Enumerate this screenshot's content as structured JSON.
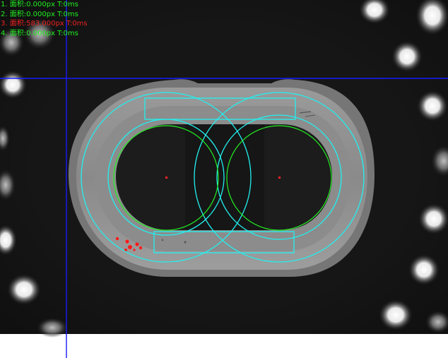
{
  "results": [
    {
      "text": "1. 面积:0.000px  T:0ms",
      "color": "#22ee22"
    },
    {
      "text": "2. 面积:0.000px  T:0ms",
      "color": "#22ee22"
    },
    {
      "text": "3. 面积:583.000px  T:0ms",
      "color": "#ee2222"
    },
    {
      "text": "4. 面积:0.000px  T:0ms",
      "color": "#22ee22"
    }
  ],
  "colors": {
    "crosshair": "#1a1aff",
    "roi": "#22f0f0",
    "hole_outline": "#22ee22",
    "center_mark": "#ff2222",
    "defect": "#ff1a1a",
    "ok_text": "#22ee22",
    "ng_text": "#ee2222"
  }
}
